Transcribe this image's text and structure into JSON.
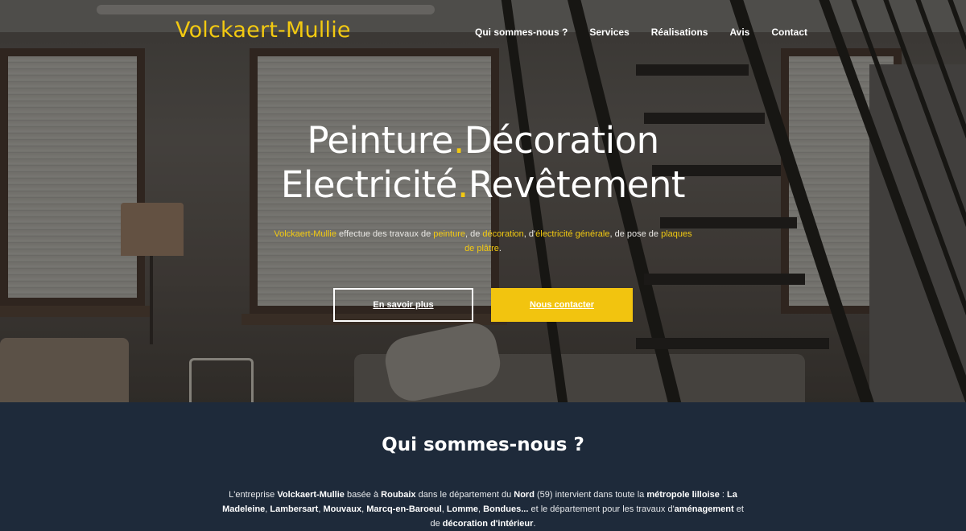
{
  "brand": {
    "logo_text": "Volckaert-Mullie",
    "accent_color": "#f2c911"
  },
  "nav": {
    "items": [
      {
        "label": "Qui sommes-nous ?"
      },
      {
        "label": "Services"
      },
      {
        "label": "Réalisations"
      },
      {
        "label": "Avis"
      },
      {
        "label": "Contact"
      }
    ]
  },
  "hero": {
    "line1": {
      "a": "Peinture",
      "dot": ".",
      "b": "Décoration"
    },
    "line2": {
      "a": "Electricité",
      "dot": ".",
      "b": "Revêtement"
    },
    "intro": {
      "brand": "Volckaert-Mullie",
      "t1": " effectue des travaux de ",
      "w1": "peinture",
      "t2": ", de ",
      "w2": "décoration",
      "t3": ", d'",
      "w3": "électricité générale",
      "t4": ", de pose de ",
      "w4": "plaques de plâtre",
      "t5": "."
    },
    "btn_more": "En savoir plus",
    "btn_contact": "Nous contacter"
  },
  "about": {
    "title": "Qui sommes-nous ?",
    "p": {
      "t1": "L'entreprise ",
      "b1": "Volckaert-Mullie",
      "t2": " basée à ",
      "b2": "Roubaix",
      "t3": " dans le département du ",
      "b3": "Nord",
      "t4": " (59) intervient dans toute la ",
      "b4": "métropole lilloise",
      "t5": " : ",
      "b5": "La Madeleine",
      "t6": ", ",
      "b6": "Lambersart",
      "t7": ", ",
      "b7": "Mouvaux",
      "t8": ", ",
      "b8": "Marcq-en-Baroeul",
      "t9": ", ",
      "b9": "Lomme",
      "t10": ", ",
      "b10": "Bondues...",
      "t11": " et le département pour les travaux d'",
      "b11": "aménagement",
      "t12": " et de ",
      "b12": "décoration d'intérieur",
      "t13": "."
    }
  }
}
